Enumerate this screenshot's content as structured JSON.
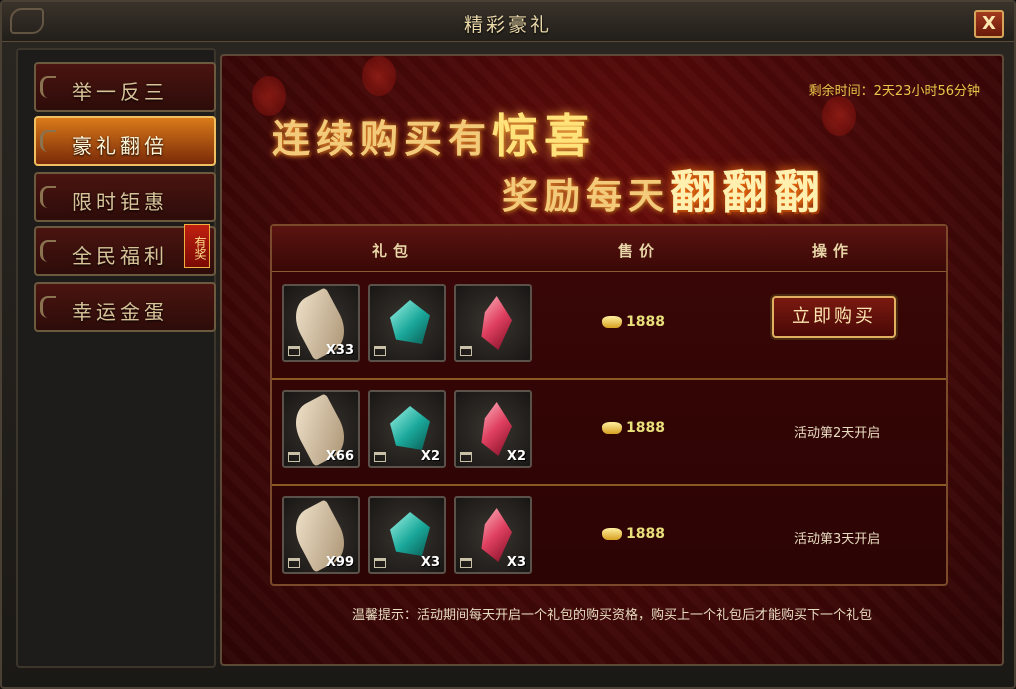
{
  "window": {
    "title": "精彩豪礼",
    "close_label": "X"
  },
  "sidebar": {
    "items": [
      {
        "label": "举一反三",
        "active": false
      },
      {
        "label": "豪礼翻倍",
        "active": true
      },
      {
        "label": "限时钜惠",
        "active": false
      },
      {
        "label": "全民福利",
        "active": false,
        "badge": "有奖"
      },
      {
        "label": "幸运金蛋",
        "active": false
      }
    ]
  },
  "main": {
    "remaining_time": "剩余时间：2天23小时56分钟",
    "banner": {
      "line1_pre": "连续购买有",
      "line1_hl": "惊喜",
      "line2_pre": "奖励每天",
      "line2_hl": "翻翻翻"
    },
    "table": {
      "headers": {
        "pack": "礼包",
        "price": "售价",
        "action": "操作"
      },
      "rows": [
        {
          "items": [
            {
              "icon": "feather-icon",
              "qty": "X33"
            },
            {
              "icon": "green-gem-icon",
              "qty": ""
            },
            {
              "icon": "red-gem-icon",
              "qty": ""
            }
          ],
          "price": "1888",
          "action_type": "button",
          "action": "立即购买"
        },
        {
          "items": [
            {
              "icon": "feather-icon",
              "qty": "X66"
            },
            {
              "icon": "green-gem-icon",
              "qty": "X2"
            },
            {
              "icon": "red-gem-icon",
              "qty": "X2"
            }
          ],
          "price": "1888",
          "action_type": "status",
          "action": "活动第2天开启"
        },
        {
          "items": [
            {
              "icon": "feather-icon",
              "qty": "X99"
            },
            {
              "icon": "green-gem-icon",
              "qty": "X3"
            },
            {
              "icon": "red-gem-icon",
              "qty": "X3"
            }
          ],
          "price": "1888",
          "action_type": "status",
          "action": "活动第3天开启"
        }
      ]
    },
    "tip": "温馨提示：活动期间每天开启一个礼包的购买资格，购买上一个礼包后才能购买下一个礼包"
  },
  "colors": {
    "accent_gold": "#e8c84a",
    "panel_red": "#4a0808",
    "active_tab": "#d97a1a"
  }
}
